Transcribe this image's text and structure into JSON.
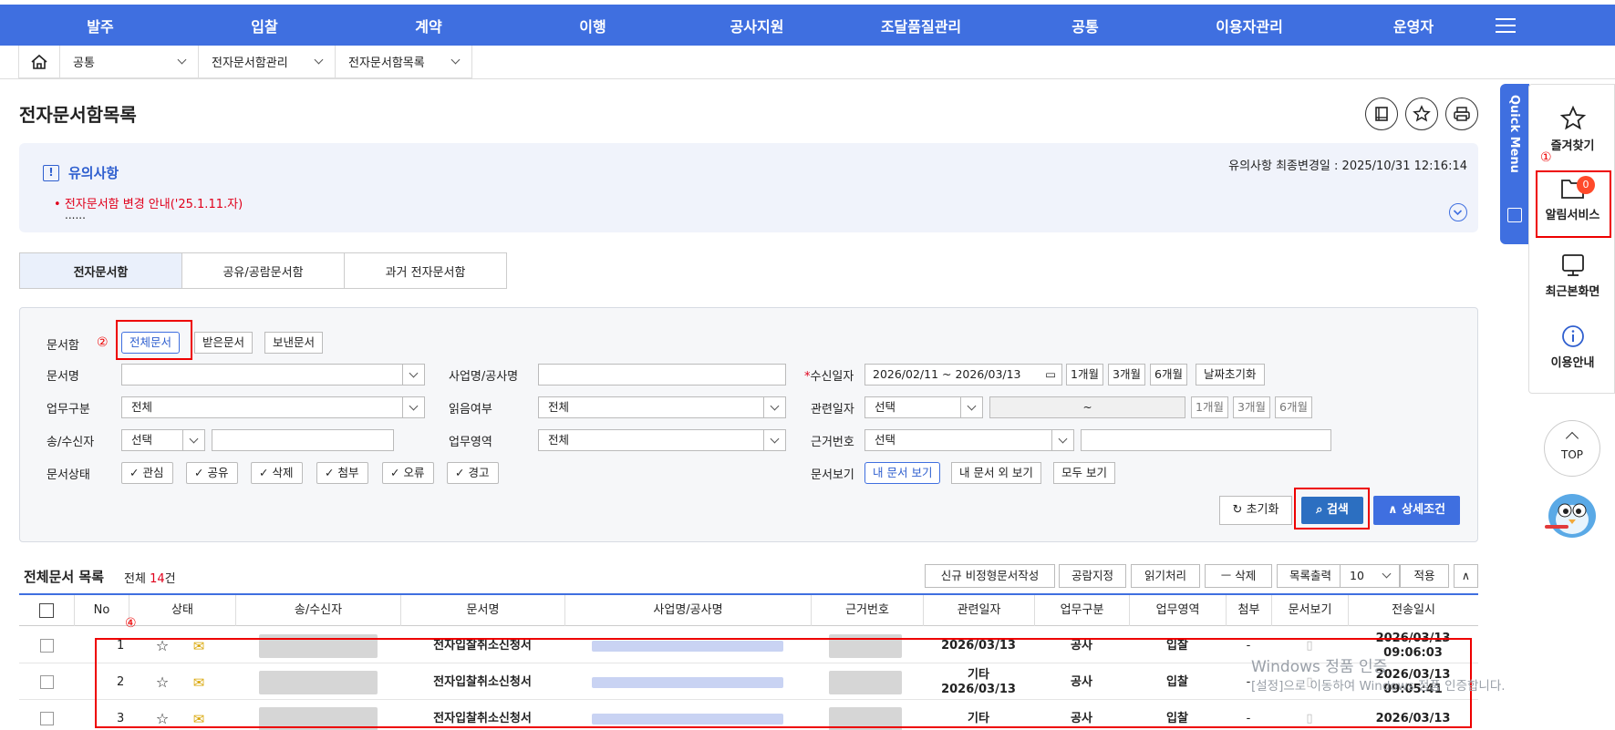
{
  "nav": [
    "발주",
    "입찰",
    "계약",
    "이행",
    "공사지원",
    "조달품질관리",
    "공통",
    "이용자관리",
    "운영자"
  ],
  "breadcrumb": [
    "공통",
    "전자문서함관리",
    "전자문서함목록"
  ],
  "page_title": "전자문서함목록",
  "notice": {
    "title": "유의사항",
    "updated": "유의사항 최종변경일 : 2025/10/31 12:16:14",
    "item": "전자문서함 변경 안내('25.1.11.자)",
    "more": "......"
  },
  "tabs": [
    "전자문서함",
    "공유/공람문서함",
    "과거 전자문서함"
  ],
  "search": {
    "box_label": "문서함",
    "box_options": [
      "전체문서",
      "받은문서",
      "보낸문서"
    ],
    "doc_name_label": "문서명",
    "project_label": "사업명/공사명",
    "recv_date_label": "수신일자",
    "recv_date_value": "2026/02/11  ~  2026/03/13",
    "period_buttons": [
      "1개월",
      "3개월",
      "6개월"
    ],
    "date_reset": "날짜초기화",
    "work_label": "업무구분",
    "work_value": "전체",
    "read_label": "읽음여부",
    "read_value": "전체",
    "rel_date_label": "관련일자",
    "rel_date_value": "선택",
    "rel_date_tilde": "~",
    "sender_label": "송/수신자",
    "sender_value": "선택",
    "area_label": "업무영역",
    "area_value": "전체",
    "basis_label": "근거번호",
    "basis_value": "선택",
    "status_label": "문서상태",
    "status_options": [
      "관심",
      "공유",
      "삭제",
      "첨부",
      "오류",
      "경고"
    ],
    "view_label": "문서보기",
    "view_options": [
      "내 문서 보기",
      "내 문서 외 보기",
      "모두 보기"
    ],
    "reset_btn": "초기화",
    "search_btn": "검색",
    "detail_btn": "상세조건"
  },
  "markers": {
    "m1": "①",
    "m2": "②",
    "m4": "④"
  },
  "list": {
    "title": "전체문서 목록",
    "count_prefix": "전체 ",
    "count": "14",
    "count_suffix": "건",
    "buttons": [
      "신규 비정형문서작성",
      "공람지정",
      "읽기처리",
      "ㅡ 삭제",
      "목록출력"
    ],
    "page_size": "10",
    "apply": "적용",
    "columns": [
      "No",
      "상태",
      "송/수신자",
      "문서명",
      "사업명/공사명",
      "근거번호",
      "관련일자",
      "업무구분",
      "업무영역",
      "첨부",
      "문서보기",
      "전송일시"
    ],
    "rows": [
      {
        "no": "1",
        "doc": "전자입찰취소신청서",
        "rel1": "",
        "rel2": "2026/03/13",
        "work": "공사",
        "area": "입찰",
        "att": "-",
        "d1": "2026/03/13",
        "d2": "09:06:03"
      },
      {
        "no": "2",
        "doc": "전자입찰취소신청서",
        "rel1": "기타",
        "rel2": "2026/03/13",
        "work": "공사",
        "area": "입찰",
        "att": "-",
        "d1": "2026/03/13",
        "d2": "09:05:41"
      },
      {
        "no": "3",
        "doc": "전자입찰취소신청서",
        "rel1": "기타",
        "rel2": "",
        "work": "공사",
        "area": "입찰",
        "att": "-",
        "d1": "2026/03/13",
        "d2": ""
      }
    ]
  },
  "quick": {
    "label": "Quick Menu",
    "items": [
      "즐겨찾기",
      "알림서비스",
      "최근본화면",
      "이용안내"
    ],
    "badge": "0",
    "top": "TOP"
  },
  "watermark": {
    "l1": "Windows 정품 인증",
    "l2": "[설정]으로 이동하여 Windows 정품 인증합니다."
  }
}
